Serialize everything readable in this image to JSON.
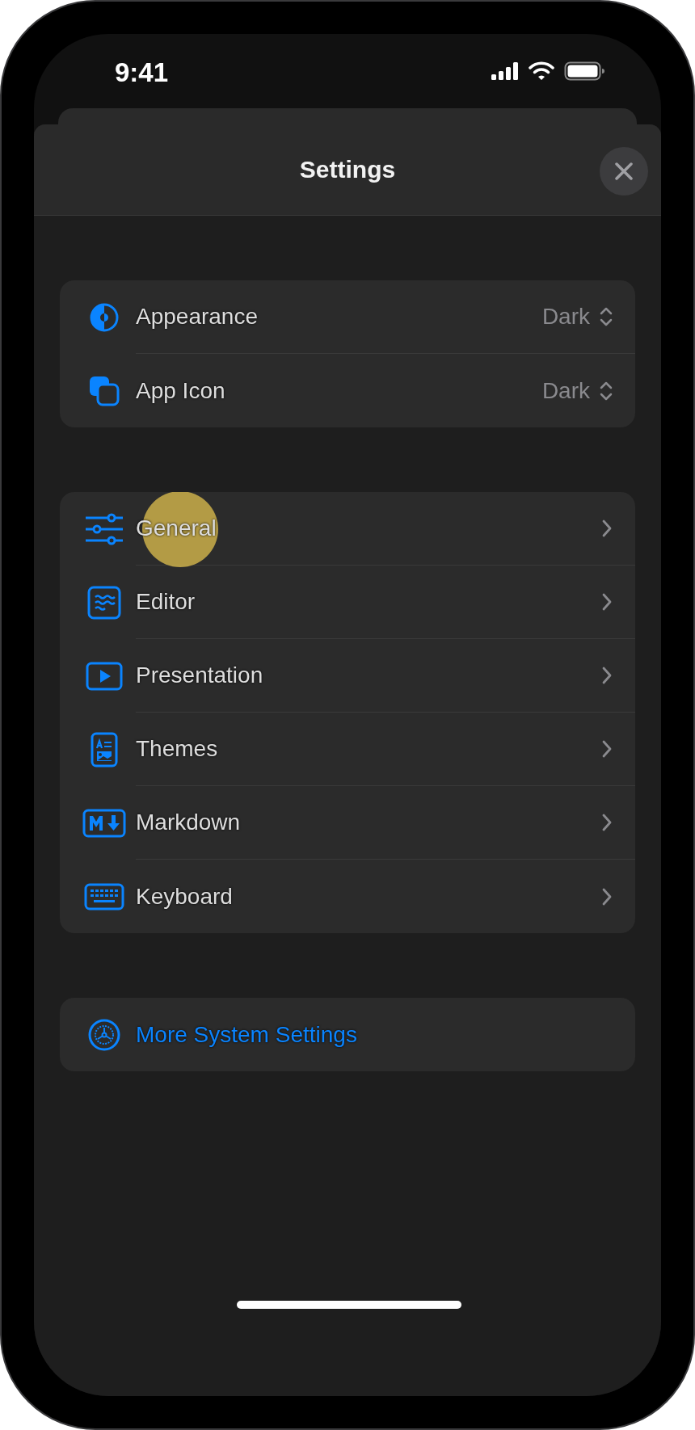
{
  "status_bar": {
    "time": "9:41"
  },
  "sheet": {
    "title": "Settings"
  },
  "groups": [
    {
      "rows": [
        {
          "kind": "picker",
          "label": "Appearance",
          "value": "Dark",
          "touched": false
        },
        {
          "kind": "picker",
          "label": "App Icon",
          "value": "Dark",
          "touched": false
        }
      ]
    },
    {
      "rows": [
        {
          "kind": "link",
          "label": "General",
          "touched": true
        },
        {
          "kind": "link",
          "label": "Editor",
          "touched": false
        },
        {
          "kind": "link",
          "label": "Presentation",
          "touched": false
        },
        {
          "kind": "link",
          "label": "Themes",
          "touched": false
        },
        {
          "kind": "link",
          "label": "Markdown",
          "touched": false
        },
        {
          "kind": "link",
          "label": "Keyboard",
          "touched": false
        }
      ]
    },
    {
      "rows": [
        {
          "kind": "action",
          "label": "More System Settings",
          "touched": false
        }
      ]
    }
  ]
}
